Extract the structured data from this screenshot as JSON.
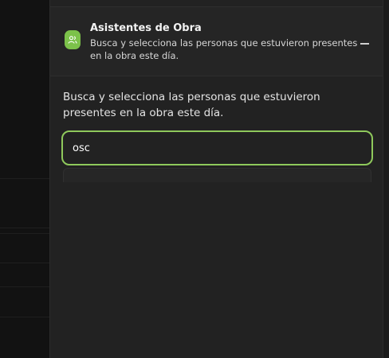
{
  "panel": {
    "header": {
      "title": "Asistentes de Obra",
      "subtitle": "Busca y selecciona las personas que estuvieron presentes en la obra este día.",
      "icon": "users-icon",
      "accent_color": "#7cc24a"
    },
    "description": "Busca y selecciona las personas que estuvieron presentes en la obra este día.",
    "search": {
      "value": "osc",
      "focus_color": "#8fc95c"
    }
  }
}
